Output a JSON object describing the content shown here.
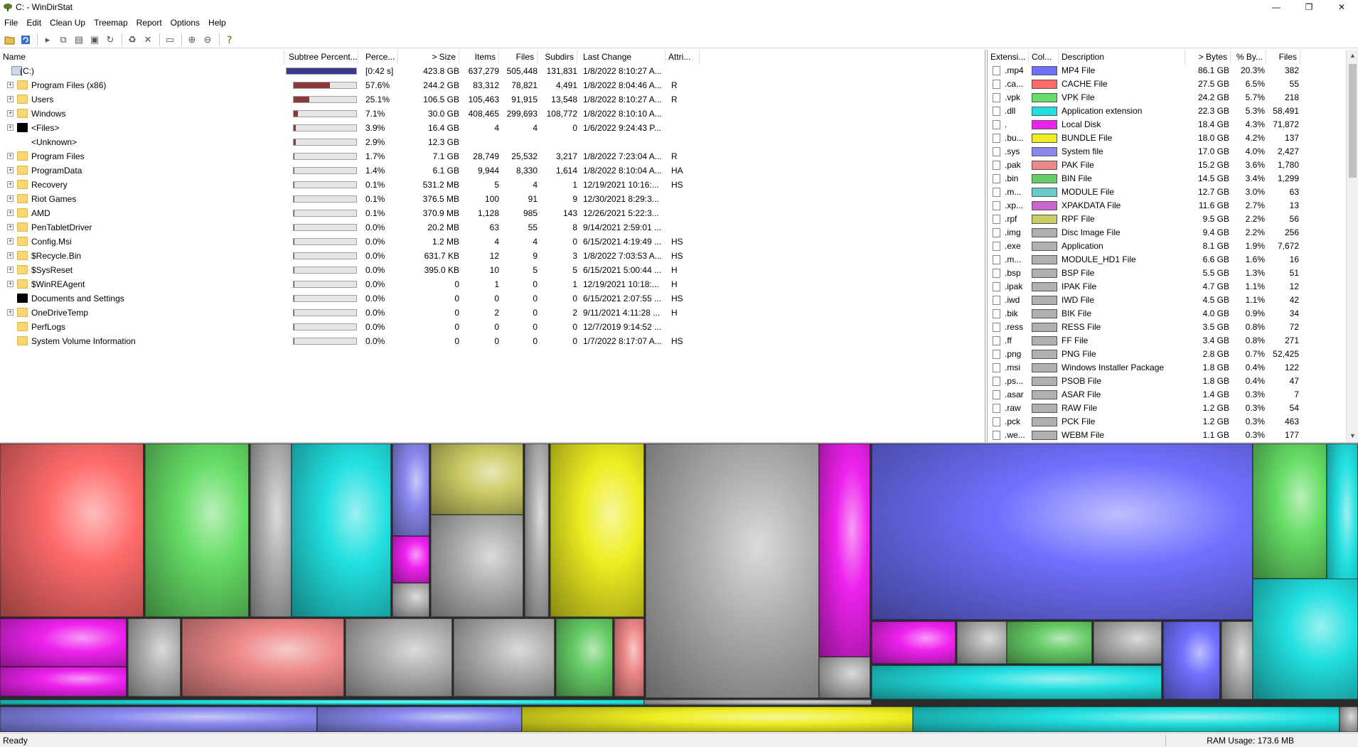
{
  "window": {
    "title": "C: - WinDirStat",
    "controls": [
      "—",
      "❐",
      "✕"
    ]
  },
  "menu": [
    "File",
    "Edit",
    "Clean Up",
    "Treemap",
    "Report",
    "Options",
    "Help"
  ],
  "toolbar": {
    "icons": [
      "open-icon",
      "refresh-icon",
      "play-icon",
      "copy-icon",
      "explorer-icon",
      "cmd-icon",
      "rescan-icon",
      "recycle-icon",
      "delete-icon",
      "new-folder-icon",
      "zoom-in-icon",
      "zoom-out-icon",
      "help-icon"
    ]
  },
  "tree": {
    "columns": [
      "Name",
      "Subtree Percent...",
      "Perce...",
      "> Size",
      "Items",
      "Files",
      "Subdirs",
      "Last Change",
      "Attri..."
    ],
    "rows": [
      {
        "name": "(C:)",
        "icon": "drive-icon",
        "expander": "",
        "indent": 0,
        "fill": 1.0,
        "root": true,
        "pct": "[0:42 s]",
        "size": "423.8 GB",
        "items": "637,279",
        "files": "505,448",
        "subdirs": "131,831",
        "changed": "1/8/2022  8:10:27 A...",
        "attr": ""
      },
      {
        "name": "Program Files (x86)",
        "icon": "folder-icon",
        "expander": "+",
        "indent": 1,
        "fill": 0.576,
        "pct": "57.6%",
        "size": "244.2 GB",
        "items": "83,312",
        "files": "78,821",
        "subdirs": "4,491",
        "changed": "1/8/2022  8:04:46 A...",
        "attr": "R"
      },
      {
        "name": "Users",
        "icon": "folder-icon",
        "expander": "+",
        "indent": 1,
        "fill": 0.251,
        "pct": "25.1%",
        "size": "106.5 GB",
        "items": "105,463",
        "files": "91,915",
        "subdirs": "13,548",
        "changed": "1/8/2022  8:10:27 A...",
        "attr": "R"
      },
      {
        "name": "Windows",
        "icon": "folder-icon",
        "expander": "+",
        "indent": 1,
        "fill": 0.071,
        "pct": "7.1%",
        "size": "30.0 GB",
        "items": "408,465",
        "files": "299,693",
        "subdirs": "108,772",
        "changed": "1/8/2022  8:10:10 A...",
        "attr": ""
      },
      {
        "name": "<Files>",
        "icon": "files-icon",
        "expander": "+",
        "indent": 1,
        "fill": 0.039,
        "pct": "3.9%",
        "size": "16.4 GB",
        "items": "4",
        "files": "4",
        "subdirs": "0",
        "changed": "1/6/2022  9:24:43 P...",
        "attr": ""
      },
      {
        "name": "<Unknown>",
        "icon": "unknown-icon",
        "expander": "",
        "indent": 1,
        "fill": 0.029,
        "pct": "2.9%",
        "size": "12.3 GB",
        "items": "",
        "files": "",
        "subdirs": "",
        "changed": "",
        "attr": ""
      },
      {
        "name": "Program Files",
        "icon": "folder-icon",
        "expander": "+",
        "indent": 1,
        "fill": 0.017,
        "pct": "1.7%",
        "size": "7.1 GB",
        "items": "28,749",
        "files": "25,532",
        "subdirs": "3,217",
        "changed": "1/8/2022  7:23:04 A...",
        "attr": "R"
      },
      {
        "name": "ProgramData",
        "icon": "folder-icon",
        "expander": "+",
        "indent": 1,
        "fill": 0.014,
        "pct": "1.4%",
        "size": "6.1 GB",
        "items": "9,944",
        "files": "8,330",
        "subdirs": "1,614",
        "changed": "1/8/2022  8:10:04 A...",
        "attr": "HA"
      },
      {
        "name": "Recovery",
        "icon": "folder-icon",
        "expander": "+",
        "indent": 1,
        "fill": 0.001,
        "pct": "0.1%",
        "size": "531.2 MB",
        "items": "5",
        "files": "4",
        "subdirs": "1",
        "changed": "12/19/2021  10:16:...",
        "attr": "HS"
      },
      {
        "name": "Riot Games",
        "icon": "folder-icon",
        "expander": "+",
        "indent": 1,
        "fill": 0.001,
        "pct": "0.1%",
        "size": "376.5 MB",
        "items": "100",
        "files": "91",
        "subdirs": "9",
        "changed": "12/30/2021  8:29:3...",
        "attr": ""
      },
      {
        "name": "AMD",
        "icon": "folder-icon",
        "expander": "+",
        "indent": 1,
        "fill": 0.001,
        "pct": "0.1%",
        "size": "370.9 MB",
        "items": "1,128",
        "files": "985",
        "subdirs": "143",
        "changed": "12/26/2021  5:22:3...",
        "attr": ""
      },
      {
        "name": "PenTabletDriver",
        "icon": "folder-icon",
        "expander": "+",
        "indent": 1,
        "fill": 0.0,
        "pct": "0.0%",
        "size": "20.2 MB",
        "items": "63",
        "files": "55",
        "subdirs": "8",
        "changed": "9/14/2021  2:59:01 ...",
        "attr": ""
      },
      {
        "name": "Config.Msi",
        "icon": "folder-icon",
        "expander": "+",
        "indent": 1,
        "fill": 0.0,
        "pct": "0.0%",
        "size": "1.2 MB",
        "items": "4",
        "files": "4",
        "subdirs": "0",
        "changed": "6/15/2021  4:19:49 ...",
        "attr": "HS"
      },
      {
        "name": "$Recycle.Bin",
        "icon": "folder-icon",
        "expander": "+",
        "indent": 1,
        "fill": 0.0,
        "pct": "0.0%",
        "size": "631.7 KB",
        "items": "12",
        "files": "9",
        "subdirs": "3",
        "changed": "1/8/2022  7:03:53 A...",
        "attr": "HS"
      },
      {
        "name": "$SysReset",
        "icon": "folder-icon",
        "expander": "+",
        "indent": 1,
        "fill": 0.0,
        "pct": "0.0%",
        "size": "395.0 KB",
        "items": "10",
        "files": "5",
        "subdirs": "5",
        "changed": "6/15/2021  5:00:44 ...",
        "attr": "H"
      },
      {
        "name": "$WinREAgent",
        "icon": "folder-icon",
        "expander": "+",
        "indent": 1,
        "fill": 0.0,
        "pct": "0.0%",
        "size": "0",
        "items": "1",
        "files": "0",
        "subdirs": "1",
        "changed": "12/19/2021  10:18:...",
        "attr": "H"
      },
      {
        "name": "Documents and Settings",
        "icon": "junction-icon",
        "expander": "",
        "indent": 1,
        "fill": 0.0,
        "pct": "0.0%",
        "size": "0",
        "items": "0",
        "files": "0",
        "subdirs": "0",
        "changed": "6/15/2021  2:07:55 ...",
        "attr": "HS"
      },
      {
        "name": "OneDriveTemp",
        "icon": "folder-icon",
        "expander": "+",
        "indent": 1,
        "fill": 0.0,
        "pct": "0.0%",
        "size": "0",
        "items": "2",
        "files": "0",
        "subdirs": "2",
        "changed": "9/11/2021  4:11:28 ...",
        "attr": "H"
      },
      {
        "name": "PerfLogs",
        "icon": "folder-icon",
        "expander": "",
        "indent": 1,
        "fill": 0.0,
        "pct": "0.0%",
        "size": "0",
        "items": "0",
        "files": "0",
        "subdirs": "0",
        "changed": "12/7/2019  9:14:52 ...",
        "attr": ""
      },
      {
        "name": "System Volume Information",
        "icon": "folder-icon",
        "expander": "",
        "indent": 1,
        "fill": 0.0,
        "pct": "0.0%",
        "size": "0",
        "items": "0",
        "files": "0",
        "subdirs": "0",
        "changed": "1/7/2022  8:17:07 A...",
        "attr": "HS"
      }
    ]
  },
  "extensions": {
    "columns": [
      "Extensi...",
      "Col...",
      "Description",
      "> Bytes",
      "% By...",
      "Files"
    ],
    "rows": [
      {
        "ext": ".mp4",
        "color": "#7070ff",
        "desc": "MP4 File",
        "bytes": "86.1 GB",
        "pct": "20.3%",
        "files": "382"
      },
      {
        "ext": ".ca...",
        "color": "#ff6b6b",
        "desc": "CACHE File",
        "bytes": "27.5 GB",
        "pct": "6.5%",
        "files": "55"
      },
      {
        "ext": ".vpk",
        "color": "#66dd66",
        "desc": "VPK File",
        "bytes": "24.2 GB",
        "pct": "5.7%",
        "files": "218"
      },
      {
        "ext": ".dll",
        "color": "#22e0e0",
        "desc": "Application extension",
        "bytes": "22.3 GB",
        "pct": "5.3%",
        "files": "58,491"
      },
      {
        "ext": ".",
        "color": "#ee22ee",
        "desc": "Local Disk",
        "bytes": "18.4 GB",
        "pct": "4.3%",
        "files": "71,872"
      },
      {
        "ext": ".bu...",
        "color": "#eeee22",
        "desc": "BUNDLE File",
        "bytes": "18.0 GB",
        "pct": "4.2%",
        "files": "137"
      },
      {
        "ext": ".sys",
        "color": "#8888ee",
        "desc": "System file",
        "bytes": "17.0 GB",
        "pct": "4.0%",
        "files": "2,427"
      },
      {
        "ext": ".pak",
        "color": "#ee8888",
        "desc": "PAK File",
        "bytes": "15.2 GB",
        "pct": "3.6%",
        "files": "1,780"
      },
      {
        "ext": ".bin",
        "color": "#66cc66",
        "desc": "BIN File",
        "bytes": "14.5 GB",
        "pct": "3.4%",
        "files": "1,299"
      },
      {
        "ext": ".m...",
        "color": "#66cccc",
        "desc": "MODULE File",
        "bytes": "12.7 GB",
        "pct": "3.0%",
        "files": "63"
      },
      {
        "ext": ".xp...",
        "color": "#cc66cc",
        "desc": "XPAKDATA File",
        "bytes": "11.6 GB",
        "pct": "2.7%",
        "files": "13"
      },
      {
        "ext": ".rpf",
        "color": "#cccc66",
        "desc": "RPF File",
        "bytes": "9.5 GB",
        "pct": "2.2%",
        "files": "56"
      },
      {
        "ext": ".img",
        "color": "#b0b0b0",
        "desc": "Disc Image File",
        "bytes": "9.4 GB",
        "pct": "2.2%",
        "files": "256"
      },
      {
        "ext": ".exe",
        "color": "#b0b0b0",
        "desc": "Application",
        "bytes": "8.1 GB",
        "pct": "1.9%",
        "files": "7,672"
      },
      {
        "ext": ".m...",
        "color": "#b0b0b0",
        "desc": "MODULE_HD1 File",
        "bytes": "6.6 GB",
        "pct": "1.6%",
        "files": "16"
      },
      {
        "ext": ".bsp",
        "color": "#b0b0b0",
        "desc": "BSP File",
        "bytes": "5.5 GB",
        "pct": "1.3%",
        "files": "51"
      },
      {
        "ext": ".ipak",
        "color": "#b0b0b0",
        "desc": "IPAK File",
        "bytes": "4.7 GB",
        "pct": "1.1%",
        "files": "12"
      },
      {
        "ext": ".iwd",
        "color": "#b0b0b0",
        "desc": "IWD File",
        "bytes": "4.5 GB",
        "pct": "1.1%",
        "files": "42"
      },
      {
        "ext": ".bik",
        "color": "#b0b0b0",
        "desc": "BIK File",
        "bytes": "4.0 GB",
        "pct": "0.9%",
        "files": "34"
      },
      {
        "ext": ".ress",
        "color": "#b0b0b0",
        "desc": "RESS File",
        "bytes": "3.5 GB",
        "pct": "0.8%",
        "files": "72"
      },
      {
        "ext": ".ff",
        "color": "#b0b0b0",
        "desc": "FF File",
        "bytes": "3.4 GB",
        "pct": "0.8%",
        "files": "271"
      },
      {
        "ext": ".png",
        "color": "#b0b0b0",
        "desc": "PNG File",
        "bytes": "2.8 GB",
        "pct": "0.7%",
        "files": "52,425"
      },
      {
        "ext": ".msi",
        "color": "#b0b0b0",
        "desc": "Windows Installer Package",
        "bytes": "1.8 GB",
        "pct": "0.4%",
        "files": "122"
      },
      {
        "ext": ".ps...",
        "color": "#b0b0b0",
        "desc": "PSOB File",
        "bytes": "1.8 GB",
        "pct": "0.4%",
        "files": "47"
      },
      {
        "ext": ".asar",
        "color": "#b0b0b0",
        "desc": "ASAR File",
        "bytes": "1.4 GB",
        "pct": "0.3%",
        "files": "7"
      },
      {
        "ext": ".raw",
        "color": "#b0b0b0",
        "desc": "RAW File",
        "bytes": "1.2 GB",
        "pct": "0.3%",
        "files": "54"
      },
      {
        "ext": ".pck",
        "color": "#b0b0b0",
        "desc": "PCK File",
        "bytes": "1.2 GB",
        "pct": "0.3%",
        "files": "463"
      },
      {
        "ext": ".we...",
        "color": "#b0b0b0",
        "desc": "WEBM File",
        "bytes": "1.1 GB",
        "pct": "0.3%",
        "files": "177"
      }
    ]
  },
  "status": {
    "text": "Ready",
    "ram": "RAM Usage:   173.6 MB"
  }
}
